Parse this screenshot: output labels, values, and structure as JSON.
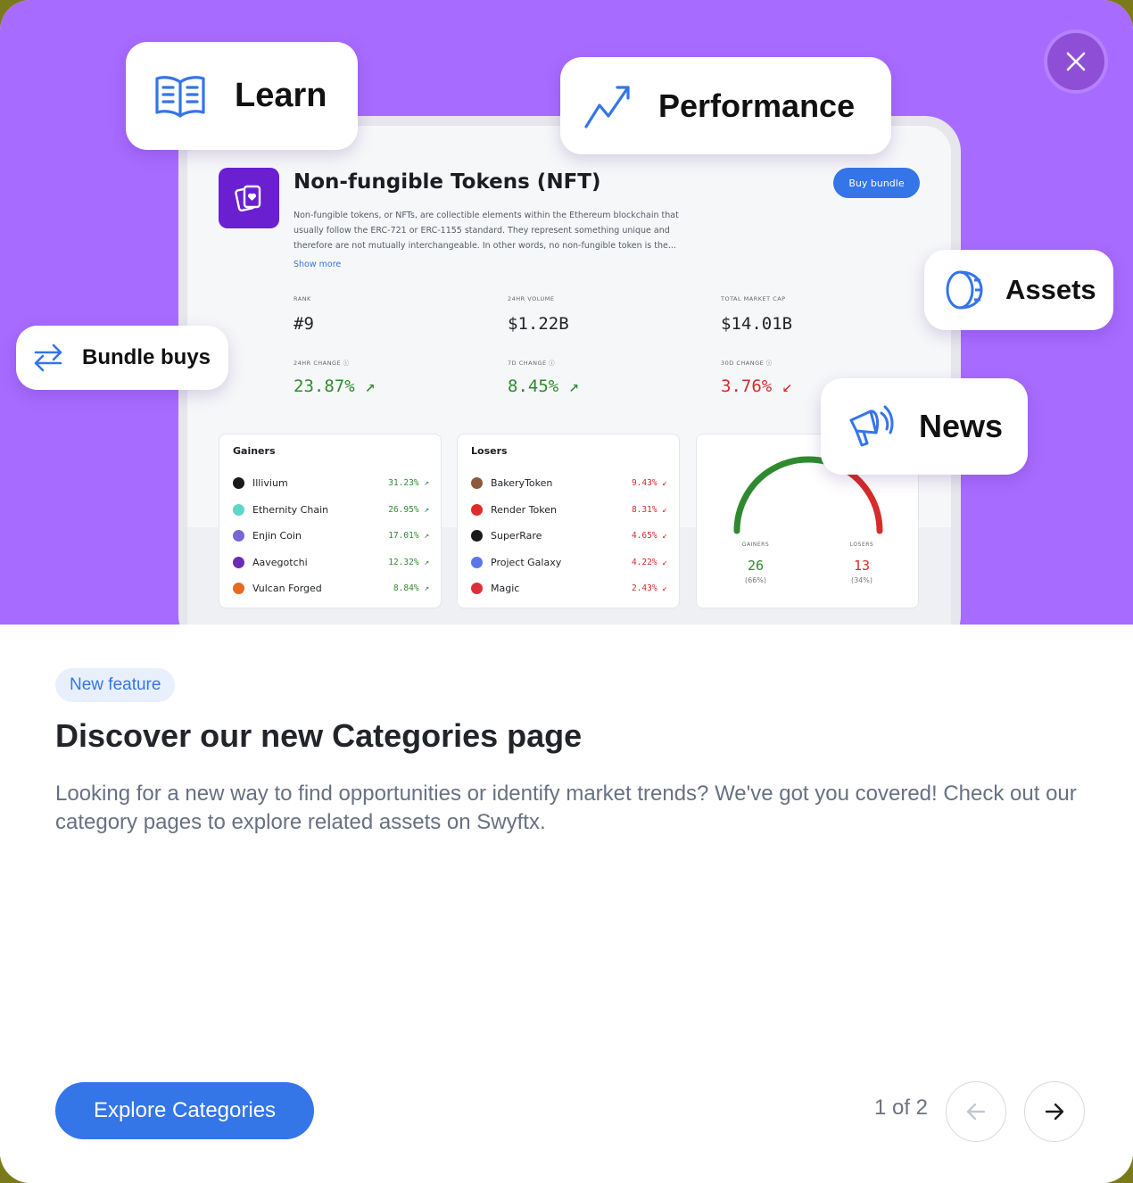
{
  "hero": {
    "close_label": "×",
    "pills": {
      "learn": "Learn",
      "performance": "Performance",
      "assets": "Assets",
      "bundle": "Bundle buys",
      "news": "News"
    },
    "category": {
      "title": "Non-fungible Tokens (NFT)",
      "buy_label": "Buy bundle",
      "description": "Non-fungible tokens, or NFTs, are collectible elements within the Ethereum blockchain that usually follow the ERC-721 or ERC-1155 standard. They represent something unique and therefore are not mutually interchangeable. In other words, no non-fungible token is the...",
      "show_more": "Show more",
      "stats": [
        {
          "label": "RANK",
          "value": "#9"
        },
        {
          "label": "24HR VOLUME",
          "value": "$1.22B"
        },
        {
          "label": "TOTAL MARKET CAP",
          "value": "$14.01B"
        }
      ],
      "changes": [
        {
          "label": "24HR CHANGE ⓘ",
          "value": "23.87% ↗",
          "direction": "up"
        },
        {
          "label": "7D CHANGE ⓘ",
          "value": "8.45% ↗",
          "direction": "up"
        },
        {
          "label": "30D CHANGE ⓘ",
          "value": "3.76% ↙",
          "direction": "down"
        }
      ],
      "gainers": {
        "title": "Gainers",
        "items": [
          {
            "name": "Illivium",
            "pct": "31.23% ↗",
            "color": "#1a1a1a"
          },
          {
            "name": "Ethernity Chain",
            "pct": "26.95% ↗",
            "color": "#5fd6c8"
          },
          {
            "name": "Enjin Coin",
            "pct": "17.01% ↗",
            "color": "#7866d5"
          },
          {
            "name": "Aavegotchi",
            "pct": "12.32% ↗",
            "color": "#6b2bb6"
          },
          {
            "name": "Vulcan Forged",
            "pct": "8.84% ↗",
            "color": "#e56b22"
          }
        ]
      },
      "losers": {
        "title": "Losers",
        "items": [
          {
            "name": "BakeryToken",
            "pct": "9.43% ↙",
            "color": "#8a5a3a"
          },
          {
            "name": "Render Token",
            "pct": "8.31% ↙",
            "color": "#e02b2b"
          },
          {
            "name": "SuperRare",
            "pct": "4.65% ↙",
            "color": "#1a1a1a"
          },
          {
            "name": "Project Galaxy",
            "pct": "4.22% ↙",
            "color": "#5a78e8"
          },
          {
            "name": "Magic",
            "pct": "2.43% ↙",
            "color": "#dc2f3c"
          }
        ]
      },
      "gauge": {
        "gainers_label": "GAINERS",
        "gainers_value": "26",
        "gainers_pct": "(66%)",
        "losers_label": "LOSERS",
        "losers_value": "13",
        "losers_pct": "(34%)",
        "gainers_fraction": 0.66
      }
    }
  },
  "content": {
    "badge": "New feature",
    "heading": "Discover our new Categories page",
    "description": "Looking for a new way to find opportunities or identify market trends? We've got you covered! Check out our category pages to explore related assets on Swyftx.",
    "cta_label": "Explore Categories",
    "pager": "1 of 2"
  },
  "colors": {
    "accent": "#3475e8",
    "hero_bg": "#a86bff",
    "gain": "#2f8a2f",
    "loss": "#d52b2b"
  }
}
